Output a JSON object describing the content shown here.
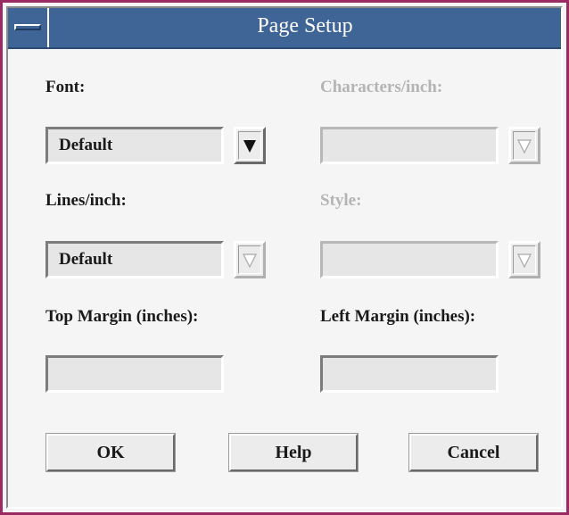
{
  "window": {
    "title": "Page Setup"
  },
  "labels": {
    "font": "Font:",
    "characters_per_inch": "Characters/inch:",
    "lines_per_inch": "Lines/inch:",
    "style": "Style:",
    "top_margin": "Top Margin (inches):",
    "left_margin": "Left Margin (inches):"
  },
  "fields": {
    "font_value": "Default",
    "characters_per_inch_value": "",
    "lines_per_inch_value": "Default",
    "style_value": "",
    "top_margin_value": "",
    "left_margin_value": ""
  },
  "buttons": {
    "ok": "OK",
    "help": "Help",
    "cancel": "Cancel"
  },
  "icons": {
    "system_menu": "system-menu-icon",
    "dropdown": "triangle-down-icon"
  },
  "colors": {
    "window_border": "#9a2a62",
    "titlebar": "#3f6496",
    "title_text": "#ffffff",
    "dialog_bg": "#f5f5f5",
    "field_bg": "#e6e6e6",
    "disabled_text": "#b4b4b4"
  },
  "states": {
    "characters_per_inch_enabled": false,
    "style_enabled": false,
    "lines_per_inch_dropdown_enabled": false
  }
}
